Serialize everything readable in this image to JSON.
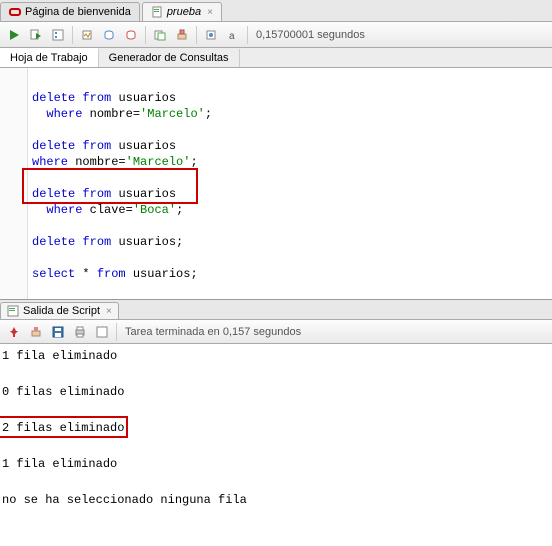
{
  "tabs": {
    "items": [
      {
        "label": "Página de bienvenida",
        "italic": false
      },
      {
        "label": "prueba",
        "italic": true
      }
    ]
  },
  "toolbar": {
    "status": "0,15700001 segundos"
  },
  "subtabs": {
    "worksheet": "Hoja de Trabajo",
    "querybuilder": "Generador de Consultas"
  },
  "code": {
    "l1_kw1": "delete",
    "l1_kw2": "from",
    "l1_id": "usuarios",
    "l2_kw1": "where",
    "l2_id": "nombre=",
    "l2_str": "'Marcelo'",
    "l2_end": ";",
    "l3_kw1": "delete",
    "l3_kw2": "from",
    "l3_id": "usuarios",
    "l4_kw1": "where",
    "l4_id": "nombre=",
    "l4_str": "'Marcelo'",
    "l4_end": ";",
    "l5_kw1": "delete",
    "l5_kw2": "from",
    "l5_id": "usuarios",
    "l6_kw1": "where",
    "l6_id": "clave=",
    "l6_str": "'Boca'",
    "l6_end": ";",
    "l7_kw1": "delete",
    "l7_kw2": "from",
    "l7_id": "usuarios;",
    "l8_kw1": "select",
    "l8_star": "*",
    "l8_kw2": "from",
    "l8_id": "usuarios;"
  },
  "output_tab": {
    "label": "Salida de Script"
  },
  "output_toolbar": {
    "status": "Tarea terminada en 0,157 segundos"
  },
  "output": {
    "r1": "1 fila eliminado",
    "r2": "0 filas eliminado",
    "r3": "2 filas eliminado",
    "r4": "1 fila eliminado",
    "r5": "no se ha seleccionado ninguna fila"
  }
}
